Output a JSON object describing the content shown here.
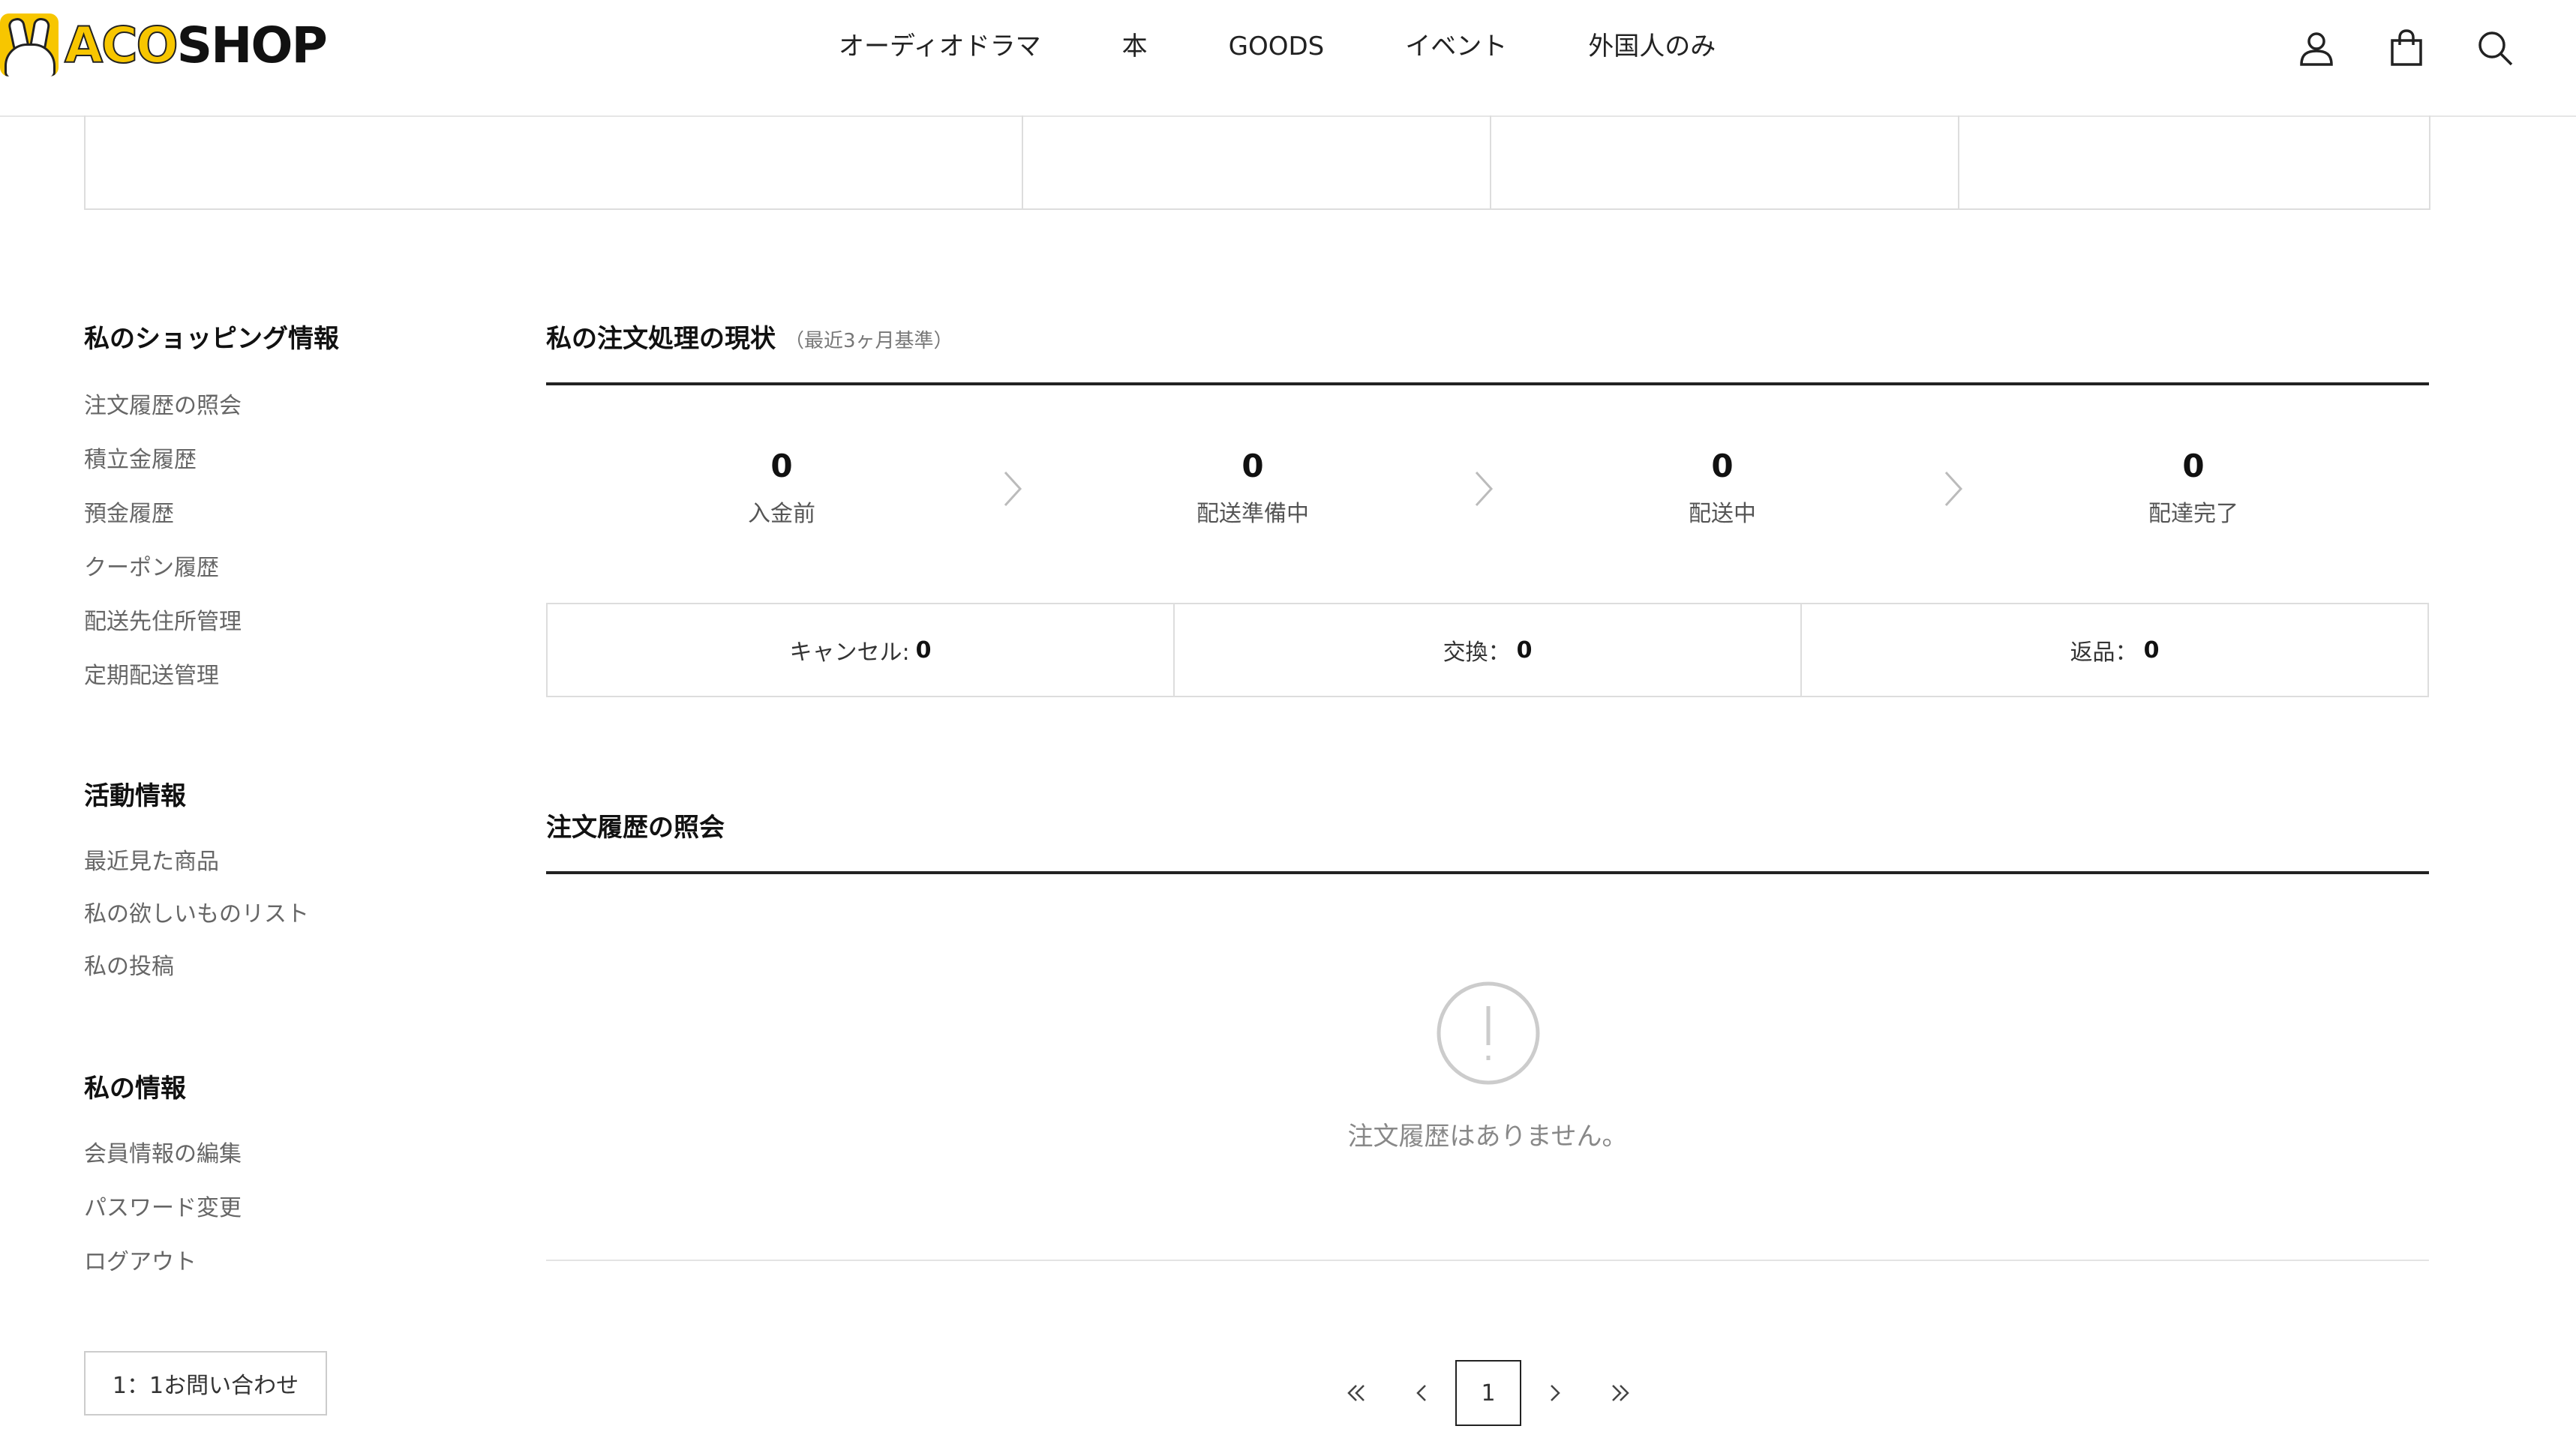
{
  "brand": {
    "logo_text_a": "ACO",
    "logo_text_b": "SHOP"
  },
  "nav": [
    "オーディオドラマ",
    "本",
    "GOODS",
    "イベント",
    "外国人のみ"
  ],
  "header_icons": [
    "user-icon",
    "bag-icon",
    "search-icon"
  ],
  "sidebar": {
    "groups": [
      {
        "title": "私のショッピング情報",
        "items": [
          "注文履歴の照会",
          "積立金履歴",
          "預金履歴",
          "クーポン履歴",
          "配送先住所管理",
          "定期配送管理"
        ]
      },
      {
        "title": "活動情報",
        "items": [
          "最近見た商品",
          "私の欲しいものリスト",
          "私の投稿"
        ]
      },
      {
        "title": "私の情報",
        "items": [
          "会員情報の編集",
          "パスワード変更",
          "ログアウト"
        ]
      }
    ],
    "contact_button": "1：1お問い合わせ"
  },
  "order_status": {
    "title": "私の注文処理の現状",
    "subtitle": "（最近3ヶ月基準）",
    "steps": [
      {
        "count": "0",
        "label": "入金前"
      },
      {
        "count": "0",
        "label": "配送準備中"
      },
      {
        "count": "0",
        "label": "配送中"
      },
      {
        "count": "0",
        "label": "配達完了"
      }
    ],
    "sub_counts": [
      {
        "label": "キャンセル:",
        "value": "0"
      },
      {
        "label": "交換：",
        "value": "0"
      },
      {
        "label": "返品：",
        "value": "0"
      }
    ]
  },
  "order_history": {
    "title": "注文履歴の照会",
    "empty_message": "注文履歴はありません。"
  },
  "pagination": {
    "current": "1"
  }
}
